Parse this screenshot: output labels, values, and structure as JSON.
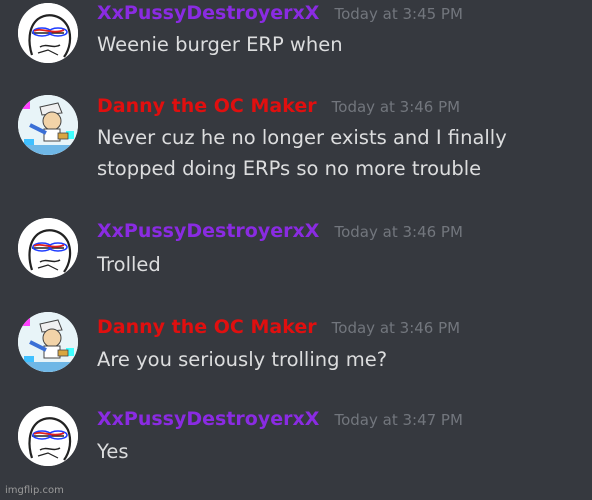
{
  "colors": {
    "background": "#36393f",
    "username_purple": "#8a2be2",
    "username_red": "#e00f0f",
    "timestamp": "#72767d",
    "message_text": "#dcddde"
  },
  "messages": [
    {
      "username": "XxPussyDestroyerxX",
      "timestamp": "Today at 3:45 PM",
      "text": "Weenie burger ERP when",
      "avatar_icon": "sketch-face-avatar-icon",
      "name_color": "#8a2be2"
    },
    {
      "username": "Danny the OC Maker",
      "timestamp": "Today at 3:46 PM",
      "text": "Never cuz he no longer exists and I finally stopped doing ERPs so no more trouble",
      "avatar_icon": "cartoon-character-avatar-icon",
      "name_color": "#e00f0f"
    },
    {
      "username": "XxPussyDestroyerxX",
      "timestamp": "Today at 3:46 PM",
      "text": "Trolled",
      "avatar_icon": "sketch-face-avatar-icon",
      "name_color": "#8a2be2"
    },
    {
      "username": "Danny the OC Maker",
      "timestamp": "Today at 3:46 PM",
      "text": "Are you seriously trolling me?",
      "avatar_icon": "cartoon-character-avatar-icon",
      "name_color": "#e00f0f"
    },
    {
      "username": "XxPussyDestroyerxX",
      "timestamp": "Today at 3:47 PM",
      "text": "Yes",
      "avatar_icon": "sketch-face-avatar-icon",
      "name_color": "#8a2be2"
    }
  ],
  "watermark": "imgflip.com"
}
